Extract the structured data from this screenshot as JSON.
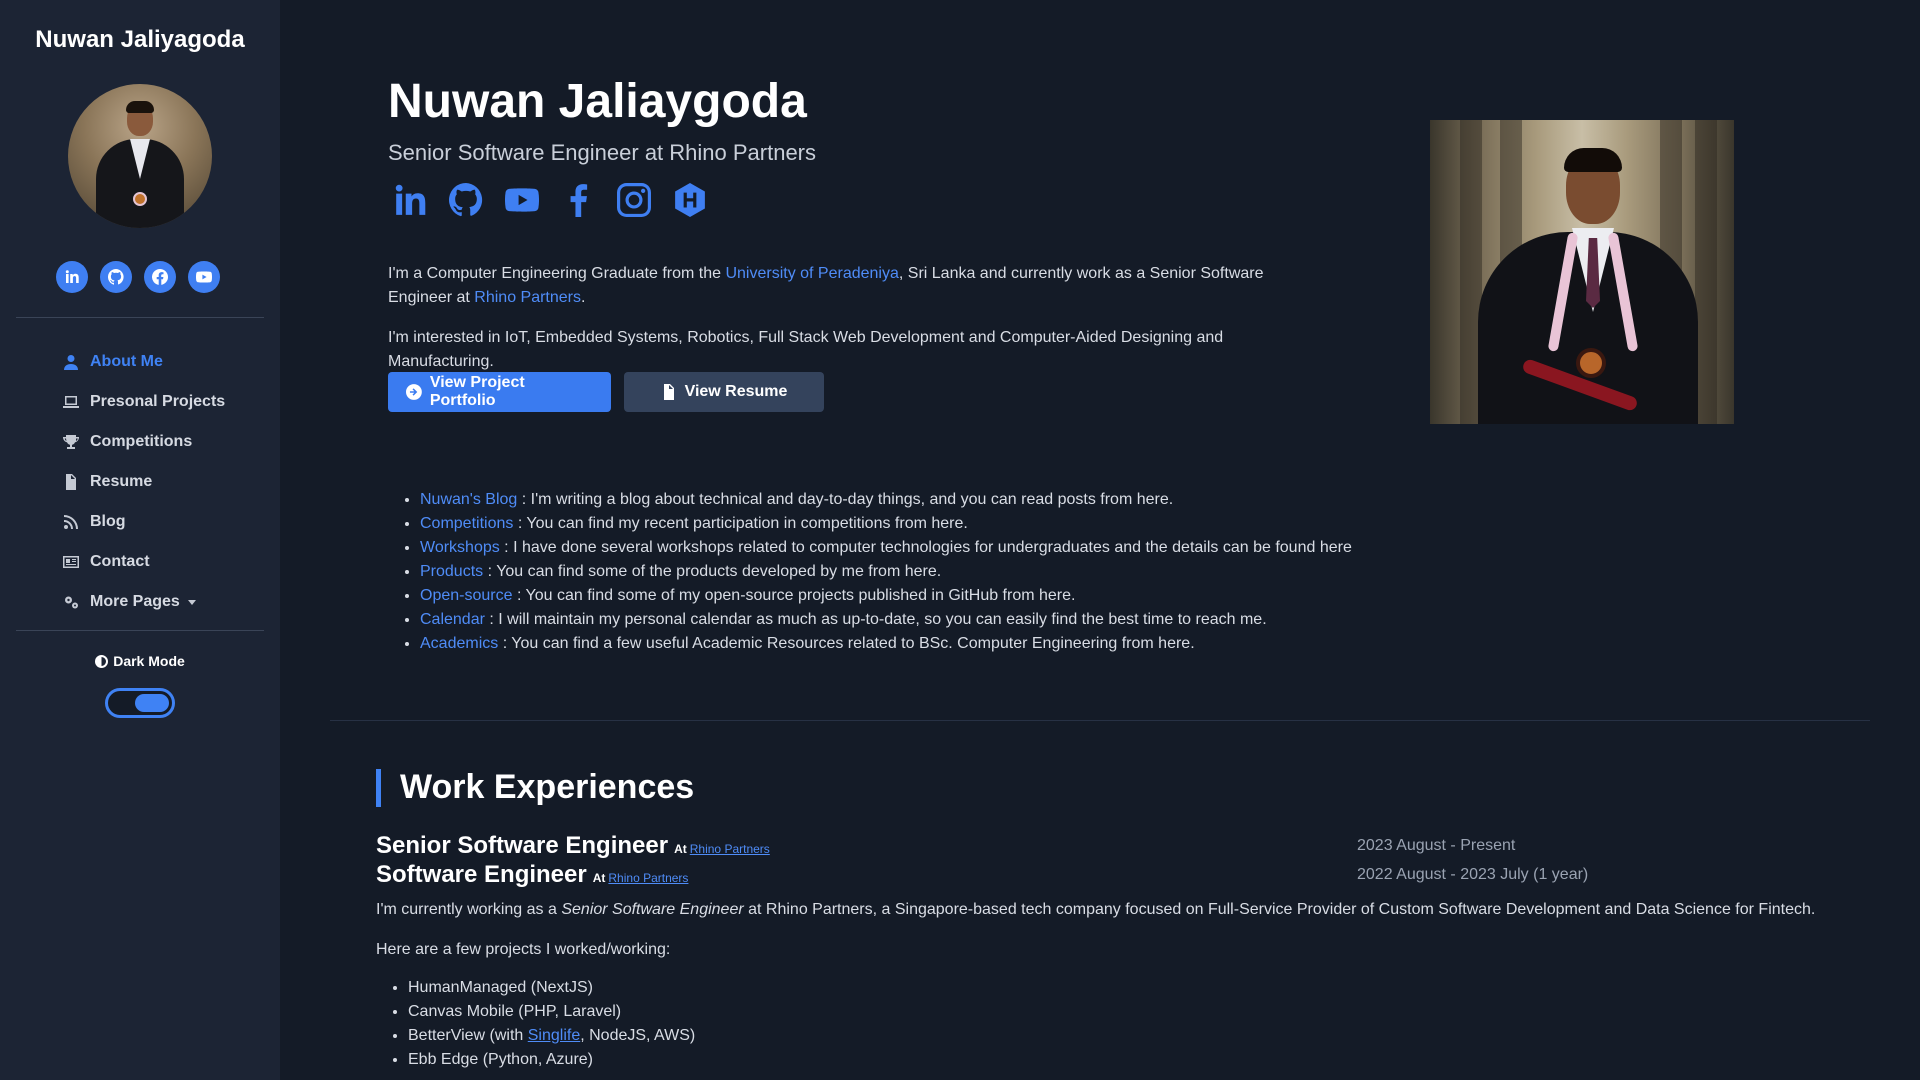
{
  "sidebar": {
    "name": "Nuwan Jaliyagoda",
    "social": [
      "linkedin-icon",
      "github-icon",
      "facebook-icon",
      "youtube-icon"
    ],
    "nav": [
      {
        "label": "About Me",
        "icon": "person-icon",
        "active": true
      },
      {
        "label": "Presonal Projects",
        "icon": "laptop-icon"
      },
      {
        "label": "Competitions",
        "icon": "trophy-icon"
      },
      {
        "label": "Resume",
        "icon": "document-icon"
      },
      {
        "label": "Blog",
        "icon": "rss-icon"
      },
      {
        "label": "Contact",
        "icon": "contact-card-icon"
      },
      {
        "label": "More Pages",
        "icon": "gears-icon"
      }
    ],
    "dark_mode_label": "Dark Mode",
    "dark_mode_on": true
  },
  "hero": {
    "name": "Nuwan Jaliaygoda",
    "role": "Senior Software Engineer at Rhino Partners",
    "social": [
      "linkedin-icon",
      "github-icon",
      "youtube-icon",
      "facebook-icon",
      "instagram-icon",
      "hashnode-icon"
    ],
    "intro1_a": "I'm a Computer Engineering Graduate from the ",
    "intro1_link1": "University of Peradeniya",
    "intro1_b": ", Sri Lanka and currently work as a Senior Software Engineer at ",
    "intro1_link2": "Rhino Partners",
    "intro1_c": ".",
    "intro2": "I'm interested in IoT, Embedded Systems, Robotics, Full Stack Web Development and Computer-Aided Designing and Manufacturing.",
    "btn_portfolio": "View Project Portfolio",
    "btn_resume": "View Resume"
  },
  "links": [
    {
      "link": "Nuwan's Blog",
      "text": " : I'm writing a blog about technical and day-to-day things, and you can read posts from here."
    },
    {
      "link": "Competitions",
      "text": " : You can find my recent participation in competitions from here."
    },
    {
      "link": "Workshops",
      "text": " : I have done several workshops related to computer technologies for undergraduates and the details can be found here"
    },
    {
      "link": "Products",
      "text": " : You can find some of the products developed by me from here."
    },
    {
      "link": "Open-source",
      "text": " : You can find some of my open-source projects published in GitHub from here."
    },
    {
      "link": "Calendar",
      "text": " : I will maintain my personal calendar as much as up-to-date, so you can easily find the best time to reach me."
    },
    {
      "link": "Academics",
      "text": " : You can find a few useful Academic Resources related to BSc. Computer Engineering from here."
    }
  ],
  "work": {
    "title": "Work Experiences",
    "jobs": [
      {
        "role": "Senior Software Engineer",
        "at": "At",
        "company": "Rhino Partners",
        "period": "2023 August - Present"
      },
      {
        "role": "Software Engineer",
        "at": "At",
        "company": "Rhino Partners",
        "period": "2022 August - 2023 July (1 year)"
      }
    ],
    "desc_a": "I'm currently working as a ",
    "desc_em": "Senior Software Engineer",
    "desc_b": " at Rhino Partners, a Singapore-based tech company focused on Full-Service Provider of Custom Software Development and Data Science for Fintech.",
    "projects_intro": "Here are a few projects I worked/working:",
    "projects": [
      {
        "text": "HumanManaged (NextJS)"
      },
      {
        "text": "Canvas Mobile (PHP, Laravel)"
      },
      {
        "pre": "BetterView (with ",
        "link": "Singlife",
        "post": ", NodeJS, AWS)"
      },
      {
        "text": "Ebb Edge (Python, Azure)"
      }
    ]
  }
}
